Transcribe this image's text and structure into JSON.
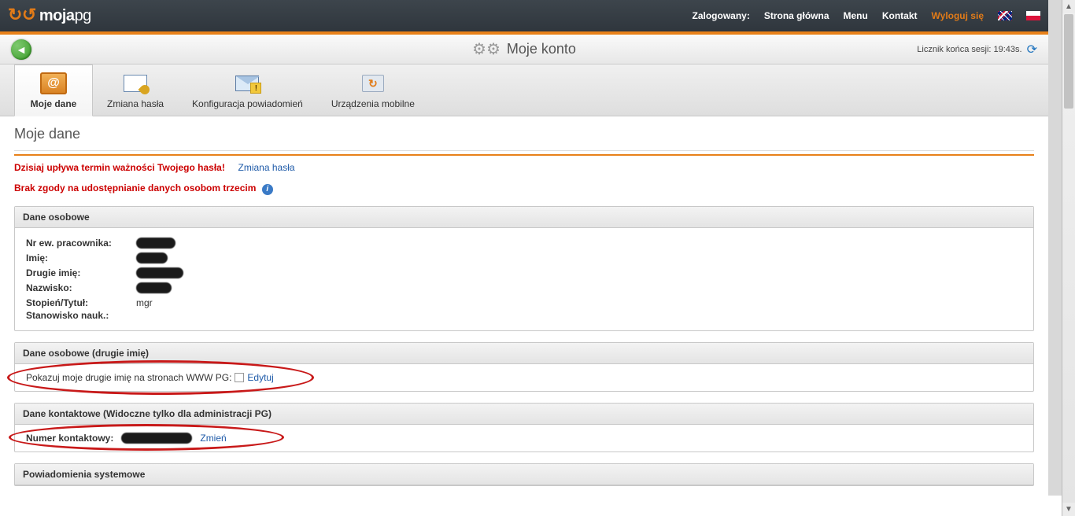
{
  "brand": {
    "name_part1": "moja",
    "name_part2": "pg"
  },
  "topnav": {
    "logged_label": "Zalogowany:",
    "home": "Strona główna",
    "menu": "Menu",
    "contact": "Kontakt",
    "logout": "Wyloguj się"
  },
  "titlebar": {
    "title": "Moje konto",
    "session": "Licznik końca sesji: 19:43s."
  },
  "tabs": [
    {
      "label": "Moje dane"
    },
    {
      "label": "Zmiana hasła"
    },
    {
      "label": "Konfiguracja powiadomień"
    },
    {
      "label": "Urządzenia mobilne"
    }
  ],
  "page": {
    "heading": "Moje dane",
    "expired_msg": "Dzisiaj upływa termin ważności Twojego hasła!",
    "change_pw_link": "Zmiana hasła",
    "consent_msg": "Brak zgody na udostępnianie danych osobom trzecim"
  },
  "panel_personal": {
    "title": "Dane osobowe",
    "fields": {
      "emp_no": "Nr ew. pracownika:",
      "first_name": "Imię:",
      "second_name": "Drugie imię:",
      "surname": "Nazwisko:",
      "degree": "Stopień/Tytuł:",
      "position": "Stanowisko nauk.:"
    },
    "degree_val": "mgr"
  },
  "panel_second": {
    "title": "Dane osobowe (drugie imię)",
    "show_label": "Pokazuj moje drugie imię na stronach WWW PG:",
    "edit": "Edytuj"
  },
  "panel_contact": {
    "title": "Dane kontaktowe (Widoczne tylko dla administracji PG)",
    "number_label": "Numer kontaktowy:",
    "change": "Zmień"
  },
  "panel_notif": {
    "title": "Powiadomienia systemowe"
  }
}
